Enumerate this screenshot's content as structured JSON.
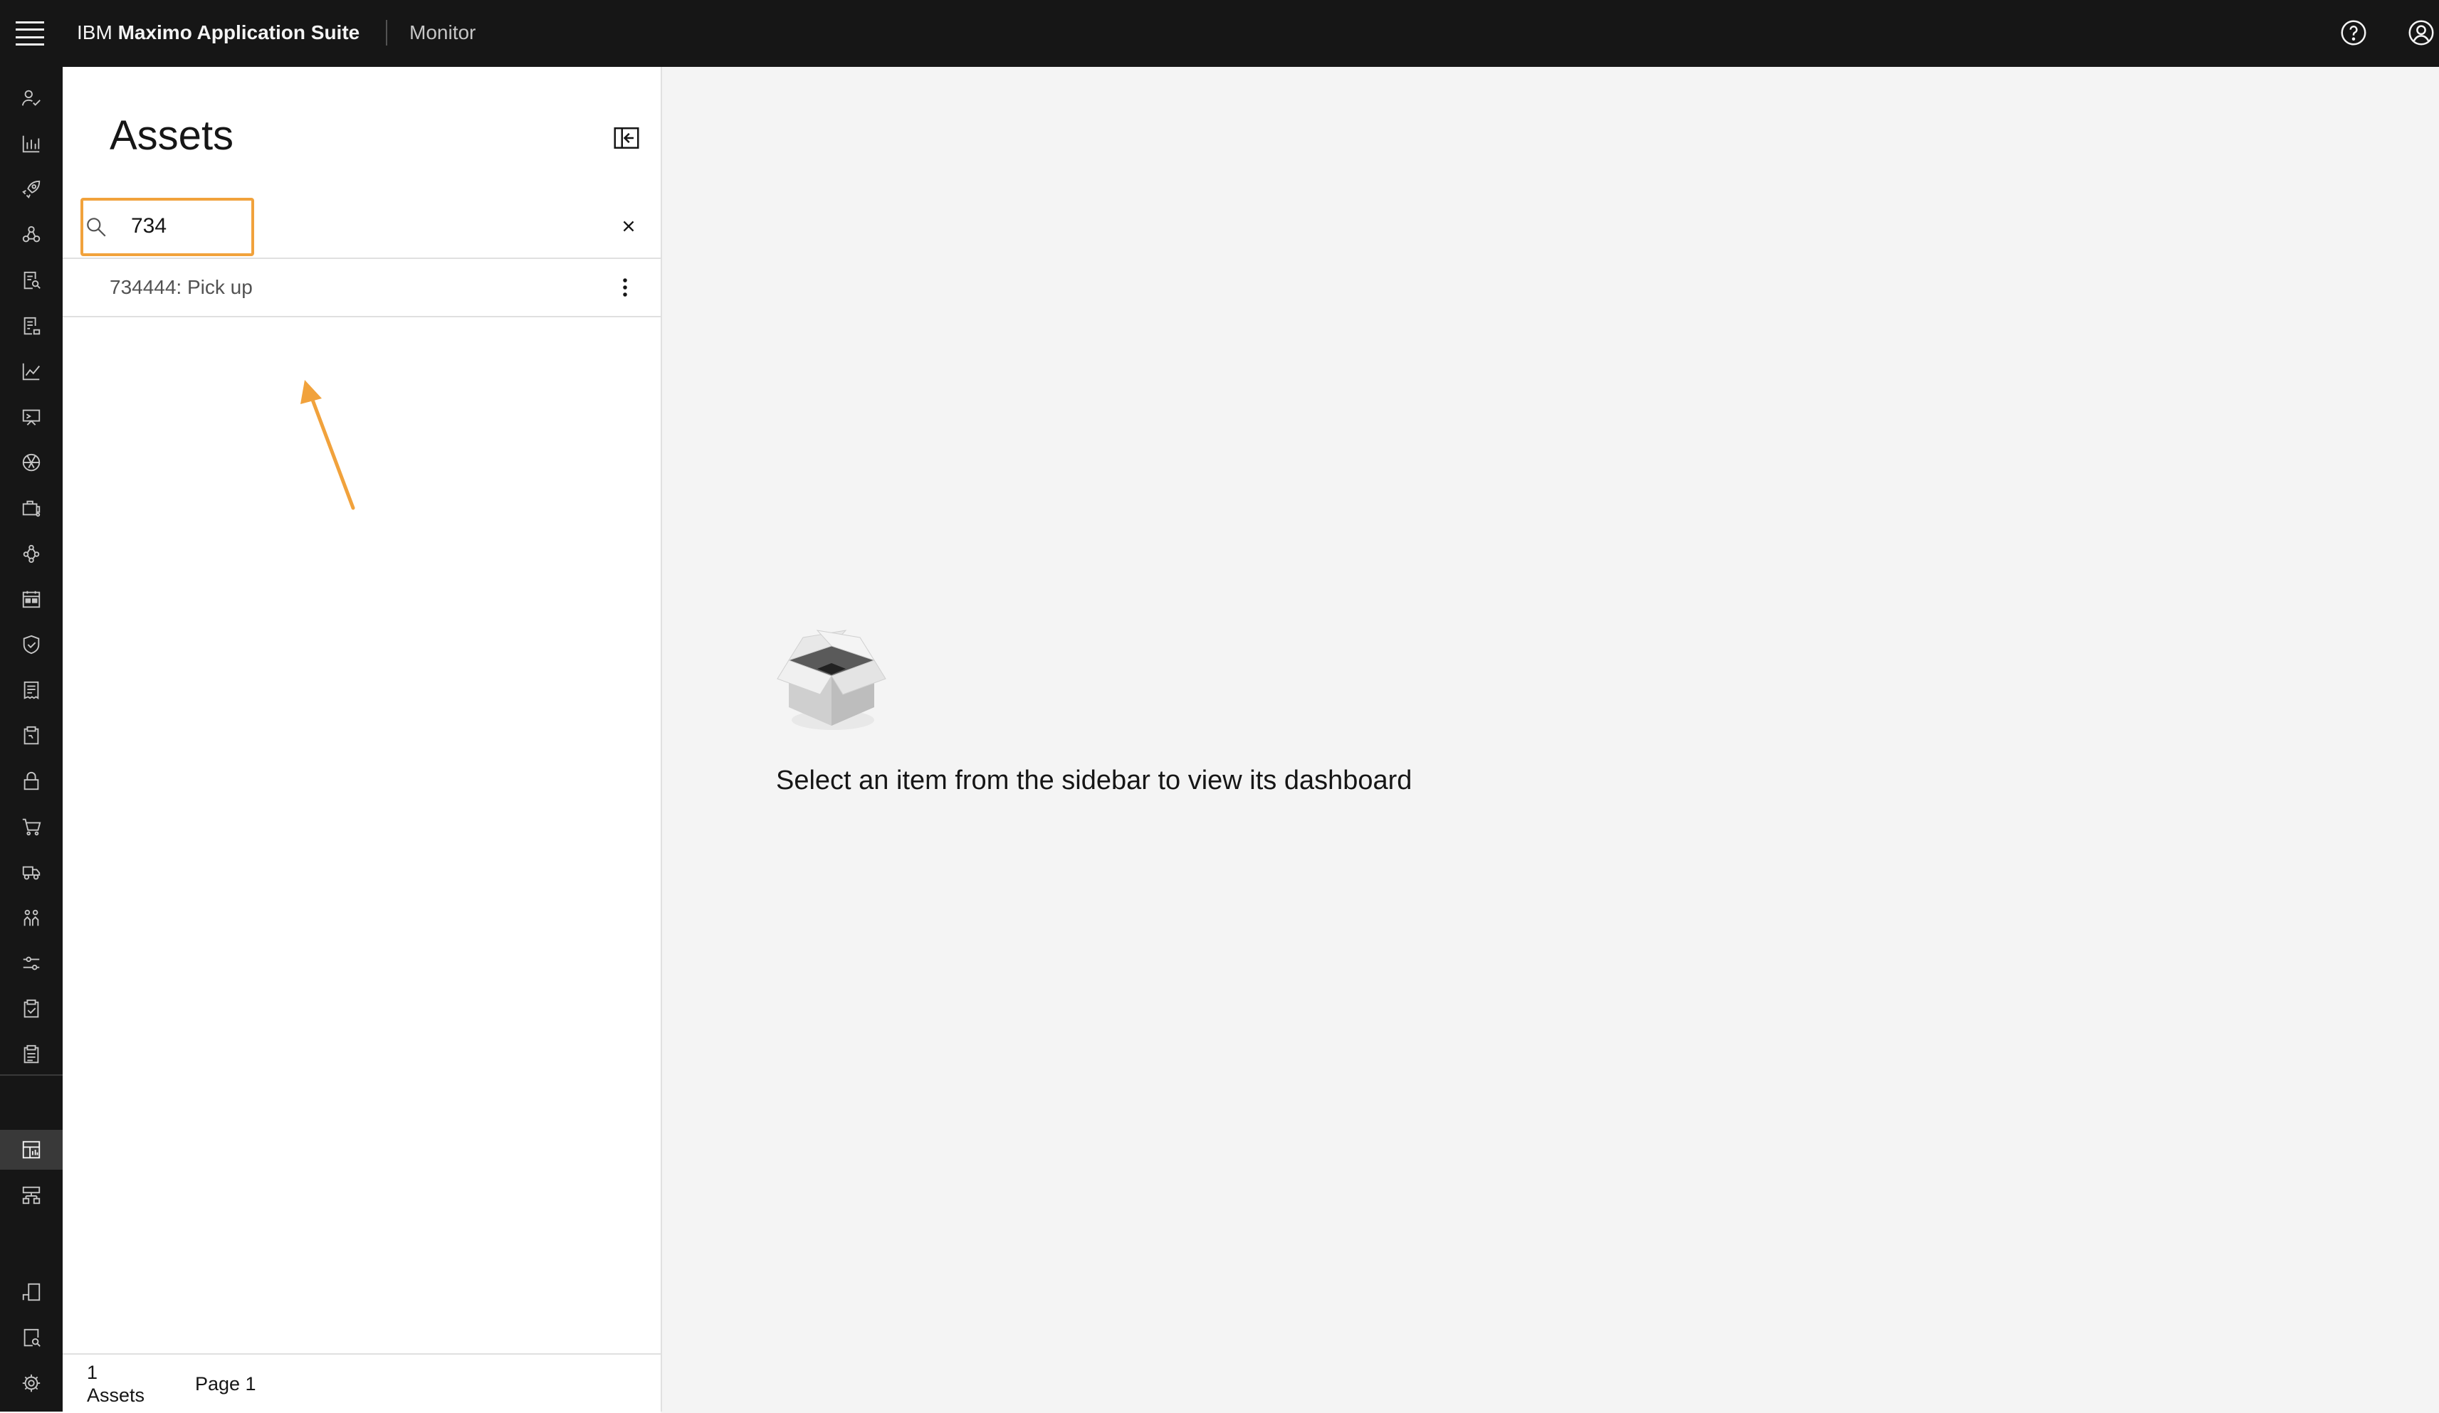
{
  "header": {
    "brand_prefix": "IBM",
    "brand_name": "Maximo Application Suite",
    "product": "Monitor"
  },
  "sidenav": {
    "items": [
      "user-check-icon",
      "bar-chart-icon",
      "rocket-icon",
      "network-icon",
      "search-document-icon",
      "document-icon",
      "line-chart-icon",
      "presentation-icon",
      "aperture-icon",
      "toolbox-icon",
      "hierarchy-icon",
      "calendar-icon",
      "shield-check-icon",
      "receipt-icon",
      "clipboard-icon",
      "lock-icon",
      "cart-icon",
      "truck-icon",
      "people-icon",
      "sliders-icon",
      "checklist-icon",
      "report-icon",
      "dashboard-icon",
      "layout-icon",
      "mobile-icon",
      "search-device-icon",
      "settings-icon"
    ],
    "active": "dashboard-icon"
  },
  "panel": {
    "title": "Assets",
    "search": {
      "value": "734",
      "placeholder": ""
    },
    "results": [
      {
        "label": "734444: Pick up"
      }
    ],
    "footer": {
      "count": "1",
      "count_label": "Assets",
      "page": "Page 1"
    }
  },
  "main": {
    "empty_message": "Select an item from the sidebar to view its dashboard"
  },
  "colors": {
    "header_bg": "#161616",
    "highlight": "#f1a23c",
    "background": "#f4f4f4"
  }
}
